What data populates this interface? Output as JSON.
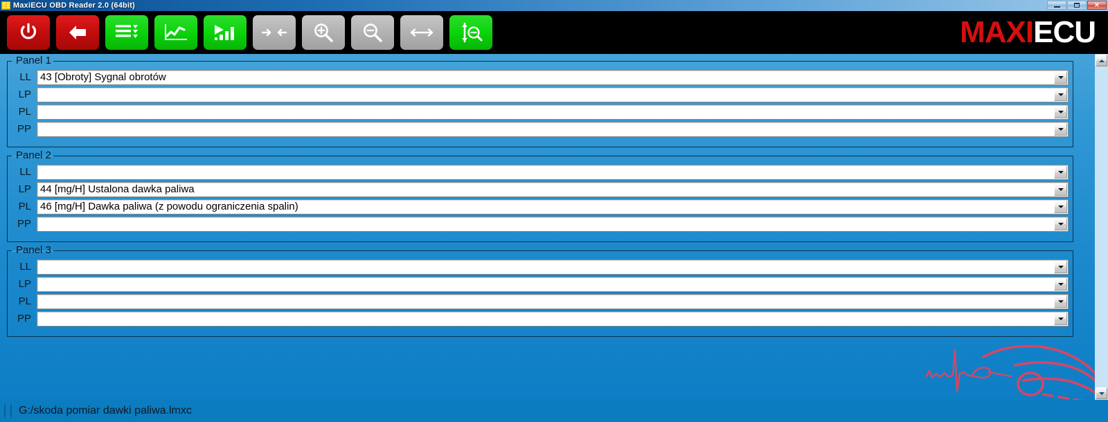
{
  "window": {
    "title": "MaxiECU OBD Reader 2.0 (64bit)",
    "app_icon": "maxiecu-app-icon",
    "controls": {
      "minimize": "minimize-button",
      "restore": "restore-button",
      "close": "close-button"
    }
  },
  "toolbar": {
    "buttons": [
      {
        "name": "power-off-button",
        "icon": "power-icon",
        "color": "#c10d0d",
        "style": "red"
      },
      {
        "name": "back-button",
        "icon": "arrow-left-icon",
        "color": "#c10d0d",
        "style": "red"
      },
      {
        "name": "parameter-list-button",
        "icon": "list-dropdown-icon",
        "color": "#0bd40b",
        "style": "green"
      },
      {
        "name": "line-chart-button",
        "icon": "line-chart-icon",
        "color": "#0bd40b",
        "style": "green"
      },
      {
        "name": "bar-chart-button",
        "icon": "play-bar-chart-icon",
        "color": "#0bd40b",
        "style": "green"
      },
      {
        "name": "collapse-button",
        "icon": "arrows-in-icon",
        "color": "#b2b2b2",
        "style": "gray"
      },
      {
        "name": "zoom-in-button",
        "icon": "magnifier-plus-icon",
        "color": "#b2b2b2",
        "style": "gray"
      },
      {
        "name": "zoom-out-button",
        "icon": "magnifier-minus-icon",
        "color": "#b2b2b2",
        "style": "gray"
      },
      {
        "name": "expand-button",
        "icon": "arrows-out-icon",
        "color": "#b2b2b2",
        "style": "gray"
      },
      {
        "name": "vertical-zoom-out-button",
        "icon": "vertical-arrows-magnifier-minus-icon",
        "color": "#0bd40b",
        "style": "green"
      }
    ]
  },
  "logo": {
    "part1": "MAXI",
    "part2": "ECU",
    "color1": "#d50f10",
    "color2": "#ffffff"
  },
  "panels": [
    {
      "title": "Panel 1",
      "rows": [
        {
          "label": "LL",
          "value": "43 [Obroty] Sygnal obrotów"
        },
        {
          "label": "LP",
          "value": ""
        },
        {
          "label": "PL",
          "value": ""
        },
        {
          "label": "PP",
          "value": ""
        }
      ]
    },
    {
      "title": "Panel 2",
      "rows": [
        {
          "label": "LL",
          "value": ""
        },
        {
          "label": "LP",
          "value": "44 [mg/H] Ustalona dawka paliwa"
        },
        {
          "label": "PL",
          "value": "46 [mg/H] Dawka paliwa (z powodu ograniczenia spalin)"
        },
        {
          "label": "PP",
          "value": ""
        }
      ]
    },
    {
      "title": "Panel 3",
      "rows": [
        {
          "label": "LL",
          "value": ""
        },
        {
          "label": "LP",
          "value": ""
        },
        {
          "label": "PL",
          "value": ""
        },
        {
          "label": "PP",
          "value": ""
        }
      ]
    }
  ],
  "scrollbar": {
    "up": "scroll-up-arrow",
    "down": "scroll-down-arrow"
  },
  "statusbar": {
    "path": "G:/skoda pomiar dawki paliwa.lmxc"
  },
  "theme": {
    "toolbar_bg": "#000000",
    "client_bg_top": "#45a3d9",
    "client_bg_bottom": "#0d7ec5",
    "status_bg": "#0b7cc0",
    "accent_red": "#d50f10",
    "accent_green": "#0bd40b"
  }
}
